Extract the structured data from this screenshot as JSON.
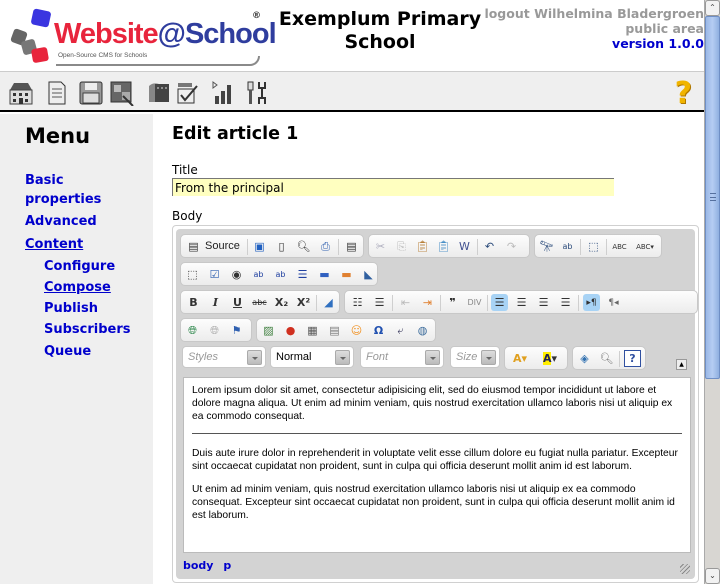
{
  "header": {
    "logo": {
      "word_part1": "Website",
      "word_part2": "@School",
      "registered": "®",
      "tagline": "Open-Source CMS for Schools"
    },
    "site_title_line1": "Exemplum Primary",
    "site_title_line2": "School",
    "logout_label": "logout Wilhelmina Bladergroen",
    "area_label": "public area",
    "version_label": "version 1.0.0"
  },
  "toolbar": {
    "icons": [
      "start-center-icon",
      "page-manager-icon",
      "file-manager-icon",
      "modules-icon",
      "account-manager-icon",
      "configuration-manager-icon",
      "statistics-icon",
      "tools-icon"
    ],
    "help_glyph": "?"
  },
  "sidebar": {
    "title": "Menu",
    "items": [
      {
        "label": "Basic",
        "label2": "properties",
        "underlined": false
      },
      {
        "label": "Advanced",
        "underlined": false
      },
      {
        "label": "Content",
        "underlined": true
      },
      {
        "label": "Configure",
        "underlined": false,
        "sub": true
      },
      {
        "label": "Compose",
        "underlined": true,
        "sub": true
      },
      {
        "label": "Publish",
        "underlined": false,
        "sub": true
      },
      {
        "label": "Subscribers",
        "underlined": false,
        "sub": true
      },
      {
        "label": "Queue",
        "underlined": false,
        "sub": true
      }
    ]
  },
  "main": {
    "heading": "Edit article 1",
    "title_label": "Title",
    "title_value": "From the principal",
    "body_label": "Body"
  },
  "editor": {
    "source_label": "Source",
    "styles_placeholder": "Styles",
    "format_value": "Normal",
    "font_placeholder": "Font",
    "size_placeholder": "Size",
    "collapse_glyph": "▲",
    "paragraphs": [
      "Lorem ipsum dolor sit amet, consectetur adipisicing elit, sed do eiusmod tempor incididunt ut labore et dolore magna aliqua. Ut enim ad minim veniam, quis nostrud exercitation ullamco laboris nisi ut aliquip ex ea commodo consequat.",
      "Duis aute irure dolor in reprehenderit in voluptate velit esse cillum dolore eu fugiat nulla pariatur. Excepteur sint occaecat cupidatat non proident, sunt in culpa qui officia deserunt mollit anim id est laborum.",
      "Ut enim ad minim veniam, quis nostrud exercitation ullamco laboris nisi ut aliquip ex ea commodo consequat. Excepteur sint occaecat cupidatat non proident, sunt in culpa qui officia deserunt mollit anim id est laborum."
    ],
    "path": [
      "body",
      "p"
    ],
    "buttons": {
      "bold": "B",
      "italic": "I",
      "underline": "U",
      "strike": "abc",
      "subscript": "X₂",
      "superscript": "X²",
      "omega": "Ω",
      "quote": "❞",
      "ltr": "▸¶",
      "rtl": "¶◂",
      "help": "?"
    }
  },
  "scrollbar": {
    "up_glyph": "⌃",
    "down_glyph": "⌄",
    "position_fraction": 0
  }
}
